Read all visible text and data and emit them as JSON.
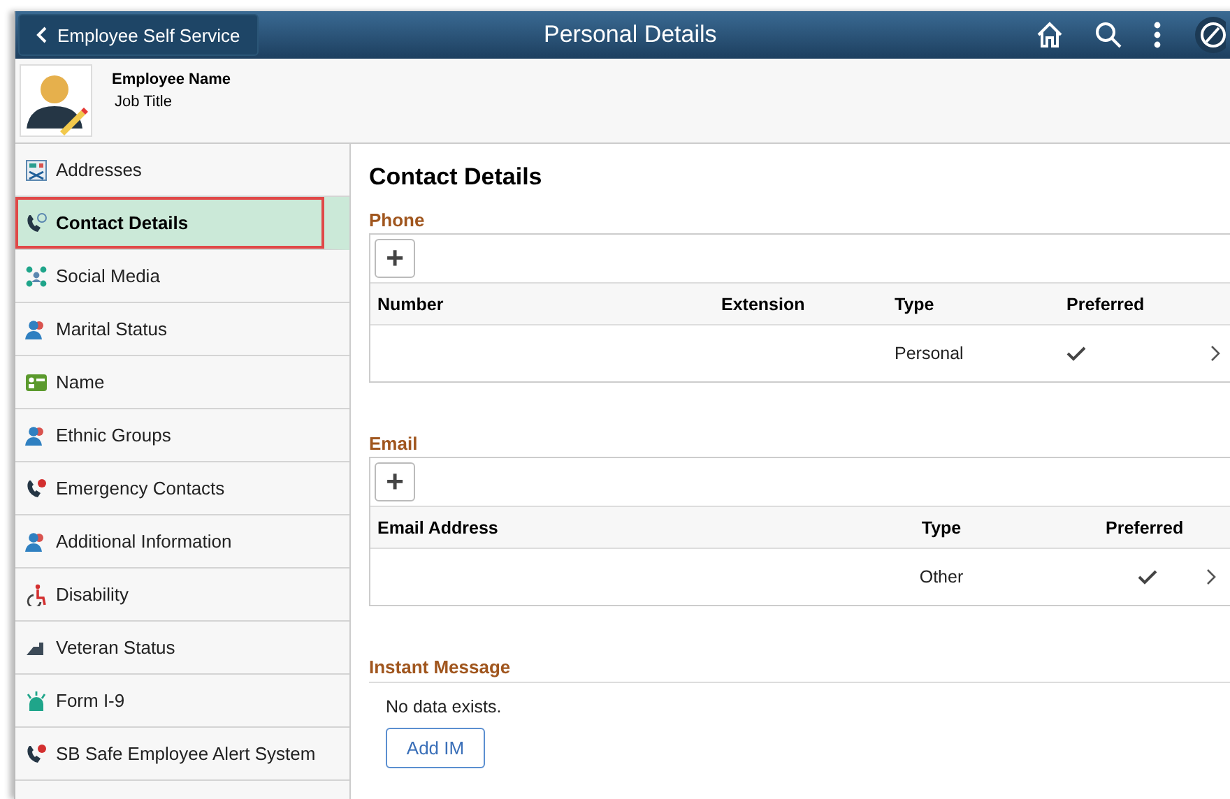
{
  "header": {
    "back_button": "Employee Self Service",
    "title": "Personal Details"
  },
  "profile": {
    "name": "Employee Name",
    "job_title": "Job Title"
  },
  "sidebar": {
    "items": [
      {
        "label": "Addresses",
        "selected": false
      },
      {
        "label": "Contact Details",
        "selected": true
      },
      {
        "label": "Social Media",
        "selected": false
      },
      {
        "label": "Marital Status",
        "selected": false
      },
      {
        "label": "Name",
        "selected": false
      },
      {
        "label": "Ethnic Groups",
        "selected": false
      },
      {
        "label": "Emergency Contacts",
        "selected": false
      },
      {
        "label": "Additional Information",
        "selected": false
      },
      {
        "label": "Disability",
        "selected": false
      },
      {
        "label": "Veteran Status",
        "selected": false
      },
      {
        "label": "Form I-9",
        "selected": false
      },
      {
        "label": "SB Safe Employee Alert System",
        "selected": false
      }
    ]
  },
  "content": {
    "title": "Contact Details",
    "phone": {
      "heading": "Phone",
      "add_button": "+",
      "columns": [
        "Number",
        "Extension",
        "Type",
        "Preferred"
      ],
      "rows": [
        {
          "type": "Personal",
          "preferred": true
        }
      ]
    },
    "email": {
      "heading": "Email",
      "add_button": "+",
      "columns": [
        "Email Address",
        "Type",
        "Preferred"
      ],
      "rows": [
        {
          "type": "Other",
          "preferred": true
        }
      ]
    },
    "instant_message": {
      "heading": "Instant Message",
      "empty_text": "No data exists.",
      "add_button": "Add IM"
    }
  }
}
